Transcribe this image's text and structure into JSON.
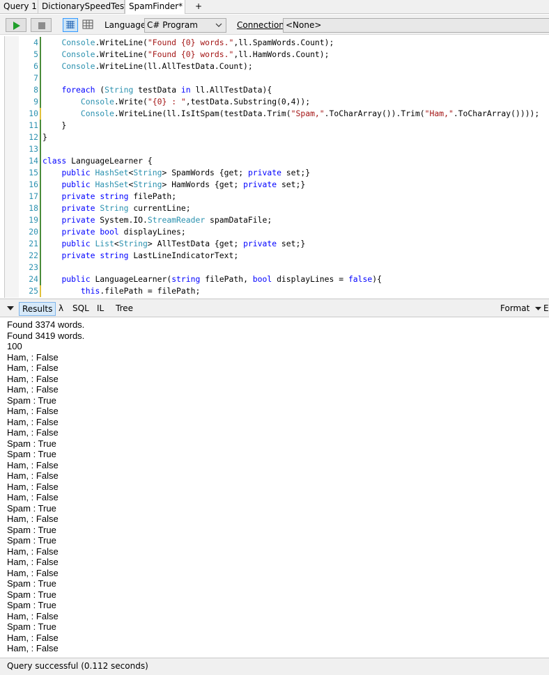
{
  "tabs": [
    {
      "label": "Query 1"
    },
    {
      "label": "DictionarySpeedTest*"
    },
    {
      "label": "SpamFinder*"
    }
  ],
  "add_tab_label": "+",
  "toolbar": {
    "language_label": "Language",
    "language_value": "C# Program",
    "connection_label": "Connection",
    "connection_value": "<None>"
  },
  "editor": {
    "lines": [
      {
        "num": "4",
        "text": "    Console.WriteLine(\"Found {0} words.\",ll.SpamWords.Count);"
      },
      {
        "num": "5",
        "text": "    Console.WriteLine(\"Found {0} words.\",ll.HamWords.Count);"
      },
      {
        "num": "6",
        "text": "    Console.WriteLine(ll.AllTestData.Count);"
      },
      {
        "num": "7",
        "text": ""
      },
      {
        "num": "8",
        "text": "    foreach (String testData in ll.AllTestData){"
      },
      {
        "num": "9",
        "text": "        Console.Write(\"{0} : \",testData.Substring(0,4));"
      },
      {
        "num": "10",
        "text": "        Console.WriteLine(ll.IsItSpam(testData.Trim(\"Spam,\".ToCharArray()).Trim(\"Ham,\".ToCharArray())));"
      },
      {
        "num": "11",
        "text": "    }"
      },
      {
        "num": "12",
        "text": "}"
      },
      {
        "num": "13",
        "text": ""
      },
      {
        "num": "14",
        "text": "class LanguageLearner {"
      },
      {
        "num": "15",
        "text": "    public HashSet<String> SpamWords {get; private set;}"
      },
      {
        "num": "16",
        "text": "    public HashSet<String> HamWords {get; private set;}"
      },
      {
        "num": "17",
        "text": "    private string filePath;"
      },
      {
        "num": "18",
        "text": "    private String currentLine;"
      },
      {
        "num": "19",
        "text": "    private System.IO.StreamReader spamDataFile;"
      },
      {
        "num": "20",
        "text": "    private bool displayLines;"
      },
      {
        "num": "21",
        "text": "    public List<String> AllTestData {get; private set;}"
      },
      {
        "num": "22",
        "text": "    private string LastLineIndicatorText;"
      },
      {
        "num": "23",
        "text": ""
      },
      {
        "num": "24",
        "text": "    public LanguageLearner(string filePath, bool displayLines = false){"
      },
      {
        "num": "25",
        "text": "        this.filePath = filePath;"
      }
    ]
  },
  "results_bar": {
    "tabs": [
      "Results",
      "λ",
      "SQL",
      "IL",
      "Tree"
    ],
    "format_label": "Format",
    "edge_label": "E"
  },
  "output": [
    "Found 3374 words.",
    "Found 3419 words.",
    "100",
    "Ham, : False",
    "Ham, : False",
    "Ham, : False",
    "Ham, : False",
    "Spam : True",
    "Ham, : False",
    "Ham, : False",
    "Ham, : False",
    "Spam : True",
    "Spam : True",
    "Ham, : False",
    "Ham, : False",
    "Ham, : False",
    "Ham, : False",
    "Spam : True",
    "Ham, : False",
    "Spam : True",
    "Spam : True",
    "Ham, : False",
    "Ham, : False",
    "Ham, : False",
    "Spam : True",
    "Spam : True",
    "Spam : True",
    "Ham, : False",
    "Spam : True",
    "Ham, : False",
    "Ham, : False"
  ],
  "status": {
    "text": "Query successful  (0.112 seconds)"
  }
}
